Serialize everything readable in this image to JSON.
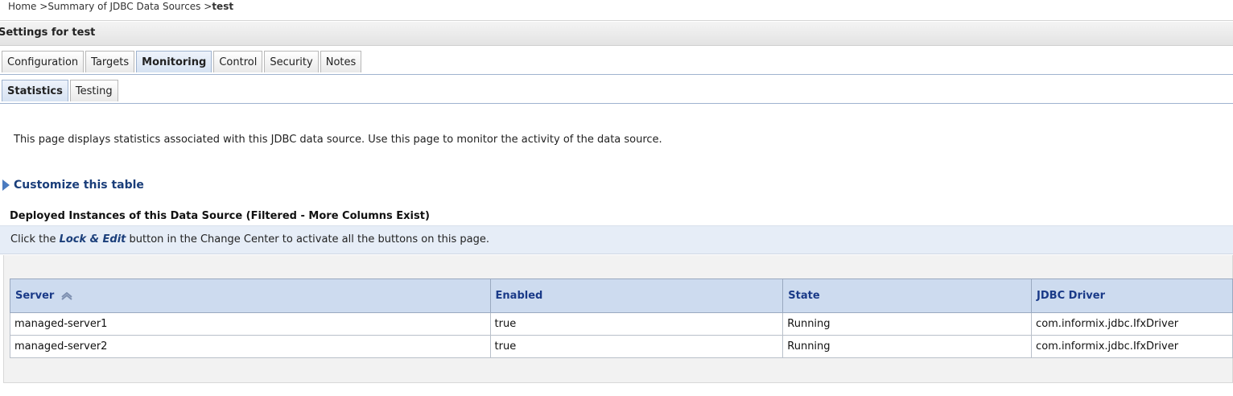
{
  "breadcrumb": {
    "home": "Home",
    "sep1": " >",
    "summary": "Summary of JDBC Data Sources",
    "sep2": " >",
    "current": "test"
  },
  "settings": {
    "title": "Settings for test"
  },
  "tabs": {
    "main": [
      "Configuration",
      "Targets",
      "Monitoring",
      "Control",
      "Security",
      "Notes"
    ],
    "main_active": "Monitoring",
    "sub": [
      "Statistics",
      "Testing"
    ],
    "sub_active": "Statistics"
  },
  "intro": "This page displays statistics associated with this JDBC data source. Use this page to monitor the activity of the data source.",
  "customize_label": "Customize this table",
  "table_title": "Deployed Instances of this Data Source (Filtered - More Columns Exist)",
  "notice": {
    "prefix": "Click the ",
    "emphasis": "Lock & Edit",
    "suffix": " button in the Change Center to activate all the buttons on this page."
  },
  "table": {
    "columns": [
      "Server",
      "Enabled",
      "State",
      "JDBC Driver"
    ],
    "rows": [
      [
        "managed-server1",
        "true",
        "Running",
        "com.informix.jdbc.IfxDriver"
      ],
      [
        "managed-server2",
        "true",
        "Running",
        "com.informix.jdbc.IfxDriver"
      ]
    ]
  },
  "colors": {
    "accent": "#1a3a88",
    "header_bg": "#cddbef",
    "notice_bg": "#e6edf7"
  }
}
